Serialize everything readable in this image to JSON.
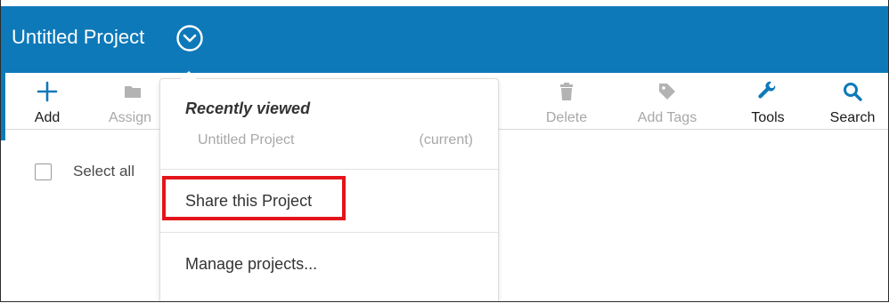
{
  "header": {
    "title": "Untitled Project",
    "menu_icon": "chevron-down-circle-icon",
    "bg_color": "#0e79b9"
  },
  "toolbar": {
    "items": [
      {
        "label": "Add",
        "icon": "plus-icon",
        "state": "active"
      },
      {
        "label": "Assign",
        "icon": "folder-icon",
        "state": "disabled"
      },
      {
        "label": "Delete",
        "icon": "trash-icon",
        "state": "disabled"
      },
      {
        "label": "Add Tags",
        "icon": "tag-icon",
        "state": "disabled"
      },
      {
        "label": "Tools",
        "icon": "wrench-icon",
        "state": "active"
      },
      {
        "label": "Search",
        "icon": "search-icon",
        "state": "active"
      }
    ]
  },
  "list": {
    "select_all_label": "Select all"
  },
  "dropdown": {
    "heading": "Recently viewed",
    "recent_project": "Untitled Project",
    "recent_status": "(current)",
    "share_label": "Share this Project",
    "manage_label": "Manage projects..."
  },
  "colors": {
    "accent": "#0e79b9",
    "highlight": "#e4141b",
    "icon_active": "#0e79b9",
    "icon_disabled": "#b3b3b3"
  }
}
